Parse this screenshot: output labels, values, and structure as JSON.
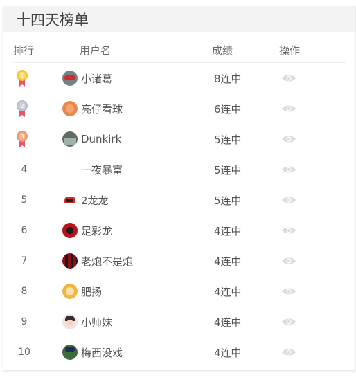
{
  "card": {
    "title": "十四天榜单",
    "columns": {
      "rank": "排行",
      "user": "用户名",
      "score": "成绩",
      "action": "操作"
    }
  },
  "rows": [
    {
      "rank": "1",
      "medal": "gold-medal-icon",
      "name": "小诸葛",
      "score": "8连中",
      "avatar": "#7a7f86"
    },
    {
      "rank": "2",
      "medal": "silver-medal-icon",
      "name": "亮仔看球",
      "score": "6连中",
      "avatar": "#e8884d"
    },
    {
      "rank": "3",
      "medal": "bronze-medal-icon",
      "name": "Dunkirk",
      "score": "5连中",
      "avatar": "#5f6b63"
    },
    {
      "rank": "4",
      "name": "一夜暴富",
      "score": "5连中",
      "avatar": ""
    },
    {
      "rank": "5",
      "name": "2龙龙",
      "score": "5连中",
      "avatar": "#c9302c"
    },
    {
      "rank": "6",
      "name": "足彩龙",
      "score": "4连中",
      "avatar": "#b8121b"
    },
    {
      "rank": "7",
      "name": "老炮不是炮",
      "score": "4连中",
      "avatar": "#8f0d14"
    },
    {
      "rank": "8",
      "name": "肥扬",
      "score": "4连中",
      "avatar": "#f2b447"
    },
    {
      "rank": "9",
      "name": "小师妹",
      "score": "4连中",
      "avatar": "#efe3e6"
    },
    {
      "rank": "10",
      "name": "梅西没戏",
      "score": "4连中",
      "avatar": "#3e6b3a"
    }
  ],
  "icons": {
    "action": "eye-icon"
  },
  "colors": {
    "gold": "#f4c430",
    "silver": "#b8bcc8",
    "bronze": "#e8996a",
    "ribbon": "#e9546b",
    "eye": "#dcdcdc"
  }
}
